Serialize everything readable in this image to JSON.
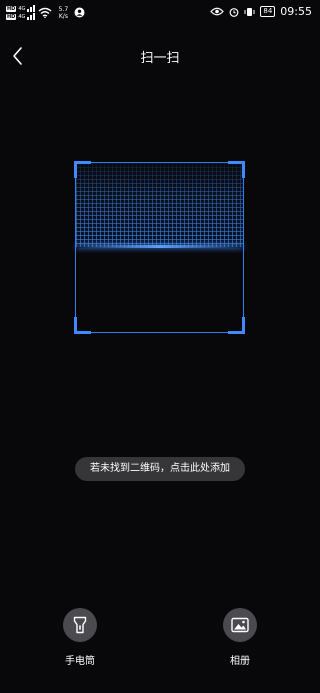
{
  "status_bar": {
    "sim1_badge": "HD",
    "sim1_net": "4G",
    "sim2_badge": "HD",
    "sim2_net": "4G",
    "speed_value": "5.7",
    "speed_unit": "K/s",
    "battery": "84",
    "time": "09:55"
  },
  "header": {
    "title": "扫一扫"
  },
  "hint": {
    "text": "若未找到二维码，点击此处添加"
  },
  "actions": {
    "flashlight_label": "手电筒",
    "album_label": "相册"
  },
  "colors": {
    "background": "#08080b",
    "accent": "#3d8bff",
    "button_bg": "#4a4a4f"
  }
}
